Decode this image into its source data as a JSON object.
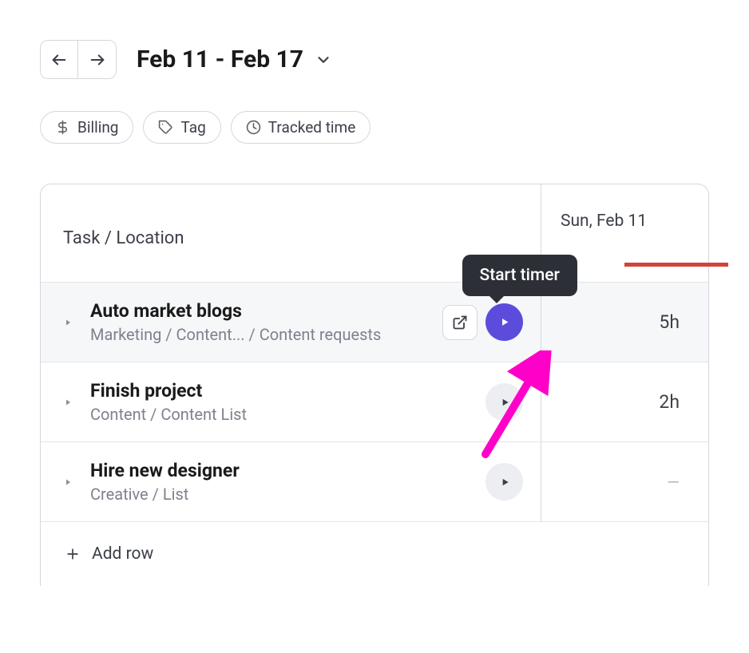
{
  "header": {
    "date_range": "Feb 11 - Feb 17"
  },
  "filters": {
    "billing": "Billing",
    "tag": "Tag",
    "tracked_time": "Tracked time"
  },
  "table": {
    "header_task": "Task / Location",
    "header_day": "Sun, Feb 11",
    "add_row": "Add row"
  },
  "tooltip": {
    "start_timer": "Start timer"
  },
  "rows": [
    {
      "title": "Auto market blogs",
      "path": "Marketing / Content... / Content requests",
      "value": "5h"
    },
    {
      "title": "Finish project",
      "path": "Content / Content List",
      "value": "2h"
    },
    {
      "title": "Hire new designer",
      "path": "Creative / List",
      "value": "—"
    }
  ]
}
